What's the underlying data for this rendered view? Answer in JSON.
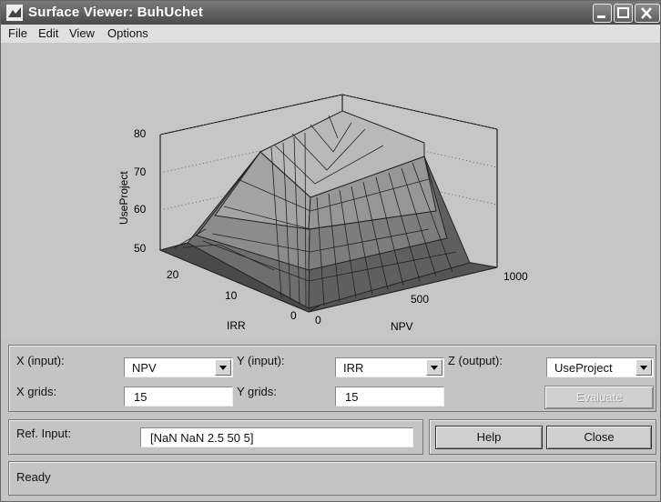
{
  "window": {
    "title": "Surface Viewer: BuhUchet"
  },
  "menu": [
    "File",
    "Edit",
    "View",
    "Options"
  ],
  "plot": {
    "z_label": "UseProject",
    "x_label": "NPV",
    "y_label": "IRR",
    "z_ticks": [
      "80",
      "70",
      "60",
      "50"
    ],
    "y_ticks": [
      "20",
      "10",
      "0"
    ],
    "x_ticks": [
      "0",
      "500",
      "1000"
    ]
  },
  "controls": {
    "x_input_label": "X (input):",
    "x_input_value": "NPV",
    "y_input_label": "Y (input):",
    "y_input_value": "IRR",
    "z_output_label": "Z (output):",
    "z_output_value": "UseProject",
    "x_grids_label": "X grids:",
    "x_grids_value": "15",
    "y_grids_label": "Y grids:",
    "y_grids_value": "15",
    "evaluate_label": "Evaluate"
  },
  "ref": {
    "label": "Ref. Input:",
    "value": "[NaN NaN 2.5 50 5]",
    "help_label": "Help",
    "close_label": "Close"
  },
  "status": {
    "text": "Ready"
  }
}
